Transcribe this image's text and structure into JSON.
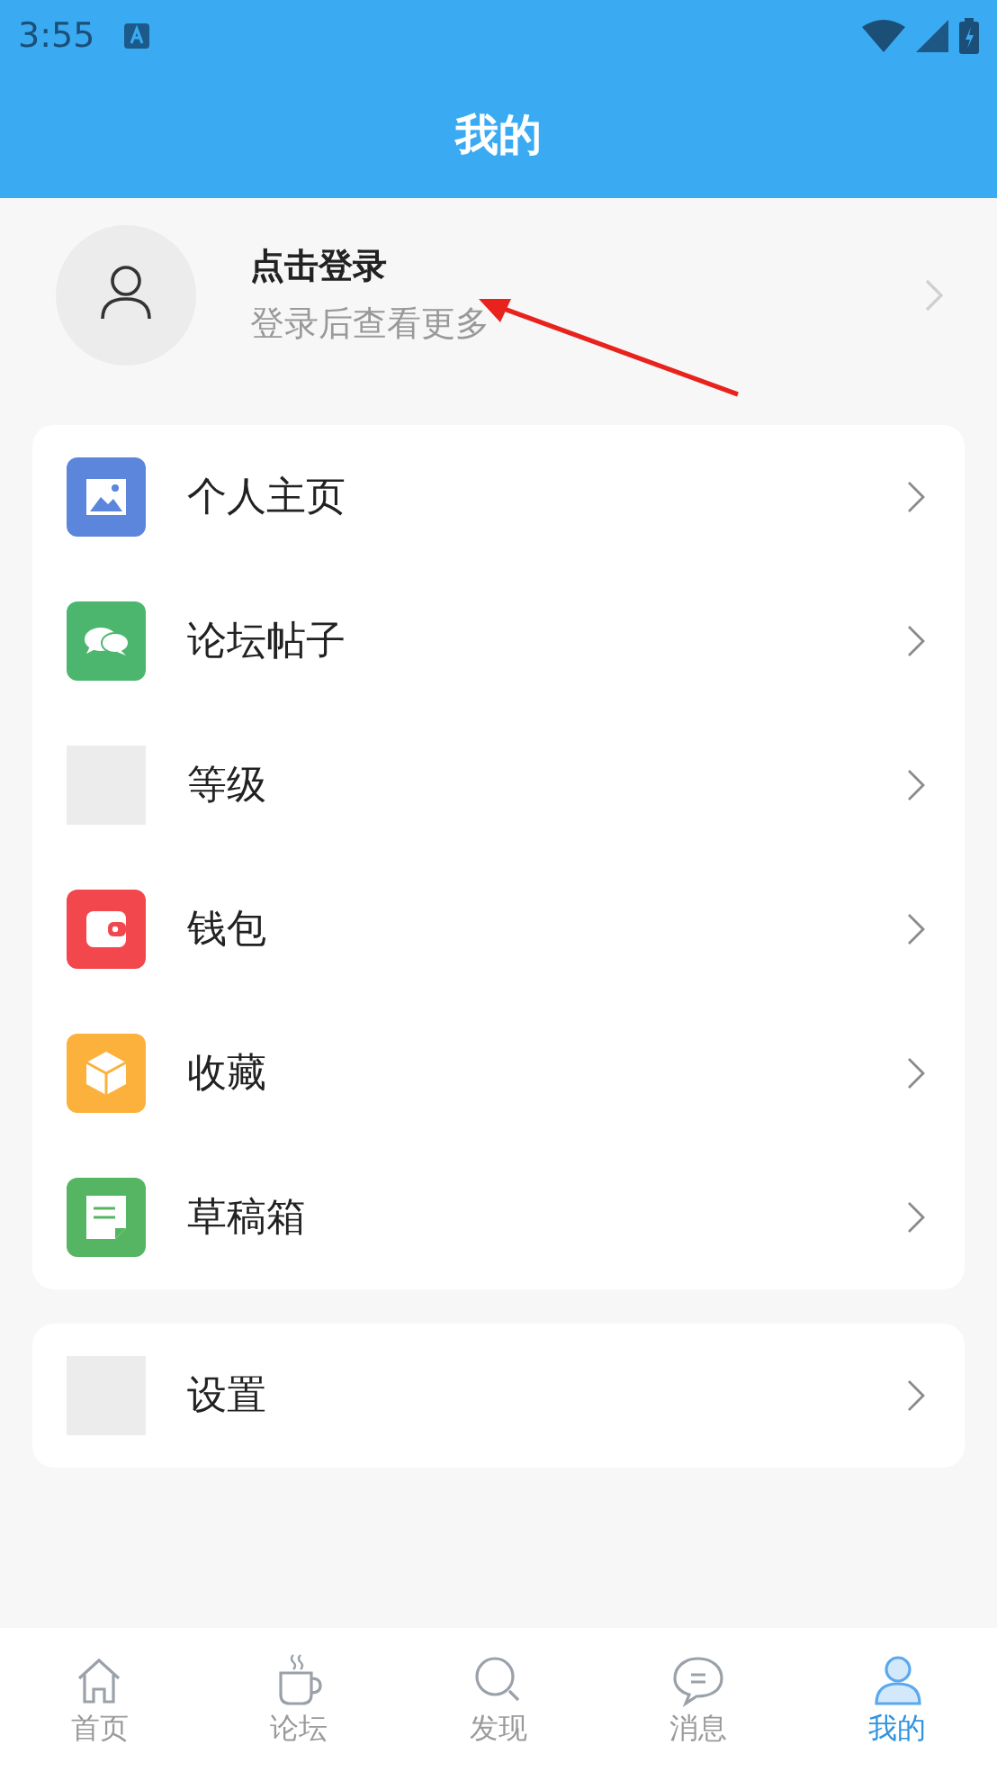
{
  "status_bar": {
    "time": "3:55"
  },
  "header": {
    "title": "我的"
  },
  "profile": {
    "name": "点击登录",
    "hint": "登录后查看更多"
  },
  "menu_groups": [
    [
      {
        "label": "个人主页",
        "kind": "picture",
        "color": "#5b86dc"
      },
      {
        "label": "论坛帖子",
        "kind": "chat",
        "color": "#4cb66f"
      },
      {
        "label": "等级",
        "kind": "blank"
      },
      {
        "label": "钱包",
        "kind": "wallet",
        "color": "#f2474d"
      },
      {
        "label": "收藏",
        "kind": "cube",
        "color": "#fcb13c"
      },
      {
        "label": "草稿箱",
        "kind": "note",
        "color": "#55b562"
      }
    ],
    [
      {
        "label": "设置",
        "kind": "blank"
      }
    ]
  ],
  "tab_bar": [
    {
      "label": "首页",
      "kind": "home",
      "selected": false
    },
    {
      "label": "论坛",
      "kind": "cup",
      "selected": false
    },
    {
      "label": "发现",
      "kind": "search",
      "selected": false
    },
    {
      "label": "消息",
      "kind": "message",
      "selected": false
    },
    {
      "label": "我的",
      "kind": "person",
      "selected": true
    }
  ]
}
